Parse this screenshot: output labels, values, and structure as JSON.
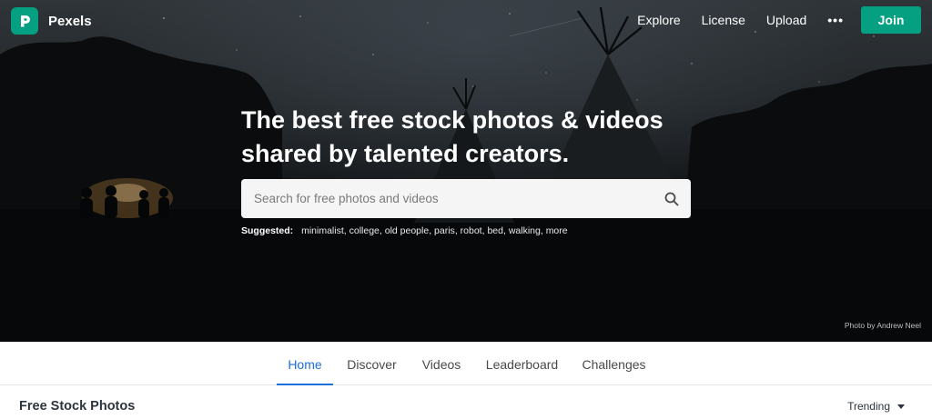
{
  "header": {
    "brand_name": "Pexels",
    "nav": [
      {
        "label": "Explore"
      },
      {
        "label": "License"
      },
      {
        "label": "Upload"
      }
    ],
    "more_label": "•••",
    "join_label": "Join"
  },
  "hero": {
    "headline": "The best free stock photos & videos shared by talented creators.",
    "search": {
      "placeholder": "Search for free photos and videos",
      "value": ""
    },
    "suggested_label": "Suggested:",
    "suggestions": [
      "minimalist",
      "college",
      "old people",
      "paris",
      "robot",
      "bed",
      "walking",
      "more"
    ],
    "photo_credit": "Photo by Andrew Neel"
  },
  "tabs": [
    {
      "label": "Home",
      "active": true
    },
    {
      "label": "Discover",
      "active": false
    },
    {
      "label": "Videos",
      "active": false
    },
    {
      "label": "Leaderboard",
      "active": false
    },
    {
      "label": "Challenges",
      "active": false
    }
  ],
  "section": {
    "title": "Free Stock Photos",
    "sort_label": "Trending"
  },
  "icons": {
    "logo": "pexels-logo-icon",
    "search": "search-icon",
    "more": "more-dots-icon",
    "sort": "chevron-down-icon"
  },
  "colors": {
    "brand": "#05a081",
    "tab_active": "#1b6fd6"
  }
}
